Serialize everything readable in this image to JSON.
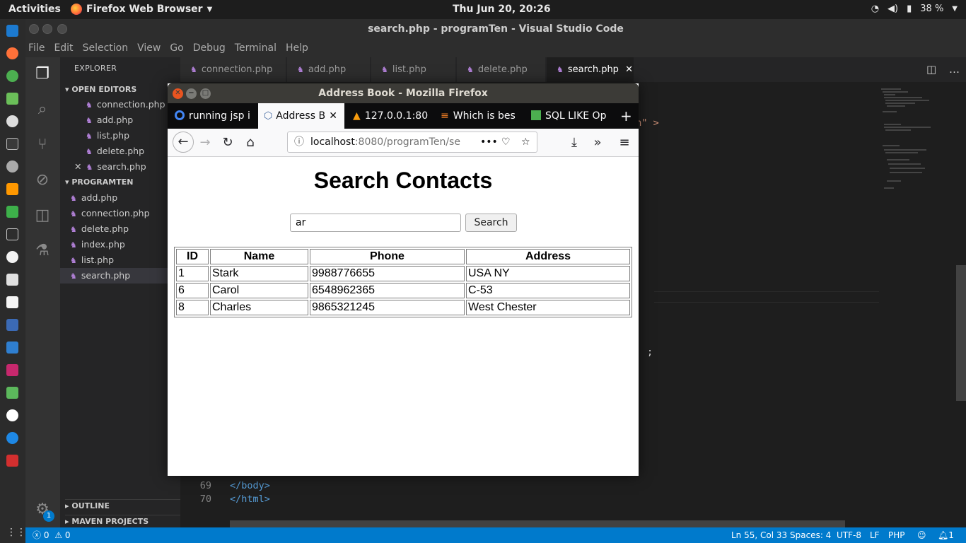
{
  "topbar": {
    "activities": "Activities",
    "app_menu": "Firefox Web Browser",
    "clock": "Thu Jun 20, 20:26",
    "battery": "38 %"
  },
  "vscode": {
    "title": "search.php - programTen - Visual Studio Code",
    "menu": [
      "File",
      "Edit",
      "Selection",
      "View",
      "Go",
      "Debug",
      "Terminal",
      "Help"
    ],
    "explorer_title": "EXPLORER",
    "open_editors_label": "OPEN EDITORS",
    "open_editors": [
      "connection.php",
      "add.php",
      "list.php",
      "delete.php",
      "search.php"
    ],
    "project_label": "PROGRAMTEN",
    "project_files": [
      "add.php",
      "connection.php",
      "delete.php",
      "index.php",
      "list.php",
      "search.php"
    ],
    "outline_label": "OUTLINE",
    "maven_label": "MAVEN PROJECTS",
    "tabs": [
      "connection.php",
      "add.php",
      "list.php",
      "delete.php",
      "search.php"
    ],
    "code_fragment_1": "rch\" >",
    "code_fragment_2": ";",
    "line_69": "69",
    "line_70": "70",
    "code_69": "</body>",
    "code_70": "</html>",
    "status": {
      "errors": "0",
      "warnings": "0",
      "position": "Ln 55, Col 33",
      "spaces": "Spaces: 4",
      "encoding": "UTF-8",
      "eol": "LF",
      "language": "PHP",
      "notifications": "1"
    },
    "settings_badge": "1"
  },
  "firefox": {
    "title": "Address Book - Mozilla Firefox",
    "tabs": [
      "running jsp i",
      "Address B",
      "127.0.0.1:80",
      "Which is bes",
      "SQL LIKE Op"
    ],
    "url_host": "localhost",
    "url_rest": ":8080/programTen/se",
    "page": {
      "heading": "Search Contacts",
      "search_value": "ar",
      "search_button": "Search",
      "columns": [
        "ID",
        "Name",
        "Phone",
        "Address"
      ],
      "rows": [
        [
          "1",
          "Stark",
          "9988776655",
          "USA NY"
        ],
        [
          "6",
          "Carol",
          "6548962365",
          "C-53"
        ],
        [
          "8",
          "Charles",
          "9865321245",
          "West Chester"
        ]
      ]
    }
  },
  "colors": {
    "vscode_status": "#007acc",
    "firefox_tabbar": "#0c0c0d",
    "php_icon": "#b180d7"
  }
}
